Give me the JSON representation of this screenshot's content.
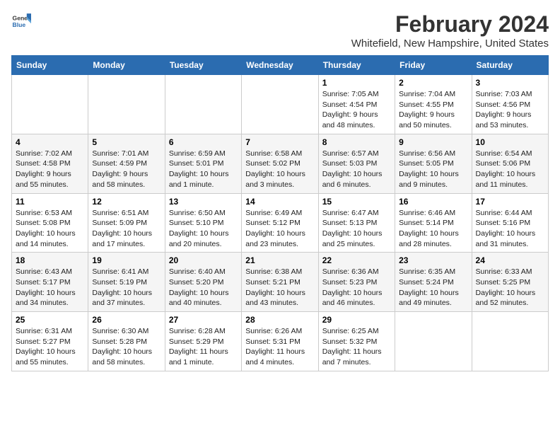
{
  "logo": {
    "general": "General",
    "blue": "Blue"
  },
  "title": "February 2024",
  "subtitle": "Whitefield, New Hampshire, United States",
  "headers": [
    "Sunday",
    "Monday",
    "Tuesday",
    "Wednesday",
    "Thursday",
    "Friday",
    "Saturday"
  ],
  "weeks": [
    [
      {
        "day": "",
        "info": ""
      },
      {
        "day": "",
        "info": ""
      },
      {
        "day": "",
        "info": ""
      },
      {
        "day": "",
        "info": ""
      },
      {
        "day": "1",
        "info": "Sunrise: 7:05 AM\nSunset: 4:54 PM\nDaylight: 9 hours\nand 48 minutes."
      },
      {
        "day": "2",
        "info": "Sunrise: 7:04 AM\nSunset: 4:55 PM\nDaylight: 9 hours\nand 50 minutes."
      },
      {
        "day": "3",
        "info": "Sunrise: 7:03 AM\nSunset: 4:56 PM\nDaylight: 9 hours\nand 53 minutes."
      }
    ],
    [
      {
        "day": "4",
        "info": "Sunrise: 7:02 AM\nSunset: 4:58 PM\nDaylight: 9 hours\nand 55 minutes."
      },
      {
        "day": "5",
        "info": "Sunrise: 7:01 AM\nSunset: 4:59 PM\nDaylight: 9 hours\nand 58 minutes."
      },
      {
        "day": "6",
        "info": "Sunrise: 6:59 AM\nSunset: 5:01 PM\nDaylight: 10 hours\nand 1 minute."
      },
      {
        "day": "7",
        "info": "Sunrise: 6:58 AM\nSunset: 5:02 PM\nDaylight: 10 hours\nand 3 minutes."
      },
      {
        "day": "8",
        "info": "Sunrise: 6:57 AM\nSunset: 5:03 PM\nDaylight: 10 hours\nand 6 minutes."
      },
      {
        "day": "9",
        "info": "Sunrise: 6:56 AM\nSunset: 5:05 PM\nDaylight: 10 hours\nand 9 minutes."
      },
      {
        "day": "10",
        "info": "Sunrise: 6:54 AM\nSunset: 5:06 PM\nDaylight: 10 hours\nand 11 minutes."
      }
    ],
    [
      {
        "day": "11",
        "info": "Sunrise: 6:53 AM\nSunset: 5:08 PM\nDaylight: 10 hours\nand 14 minutes."
      },
      {
        "day": "12",
        "info": "Sunrise: 6:51 AM\nSunset: 5:09 PM\nDaylight: 10 hours\nand 17 minutes."
      },
      {
        "day": "13",
        "info": "Sunrise: 6:50 AM\nSunset: 5:10 PM\nDaylight: 10 hours\nand 20 minutes."
      },
      {
        "day": "14",
        "info": "Sunrise: 6:49 AM\nSunset: 5:12 PM\nDaylight: 10 hours\nand 23 minutes."
      },
      {
        "day": "15",
        "info": "Sunrise: 6:47 AM\nSunset: 5:13 PM\nDaylight: 10 hours\nand 25 minutes."
      },
      {
        "day": "16",
        "info": "Sunrise: 6:46 AM\nSunset: 5:14 PM\nDaylight: 10 hours\nand 28 minutes."
      },
      {
        "day": "17",
        "info": "Sunrise: 6:44 AM\nSunset: 5:16 PM\nDaylight: 10 hours\nand 31 minutes."
      }
    ],
    [
      {
        "day": "18",
        "info": "Sunrise: 6:43 AM\nSunset: 5:17 PM\nDaylight: 10 hours\nand 34 minutes."
      },
      {
        "day": "19",
        "info": "Sunrise: 6:41 AM\nSunset: 5:19 PM\nDaylight: 10 hours\nand 37 minutes."
      },
      {
        "day": "20",
        "info": "Sunrise: 6:40 AM\nSunset: 5:20 PM\nDaylight: 10 hours\nand 40 minutes."
      },
      {
        "day": "21",
        "info": "Sunrise: 6:38 AM\nSunset: 5:21 PM\nDaylight: 10 hours\nand 43 minutes."
      },
      {
        "day": "22",
        "info": "Sunrise: 6:36 AM\nSunset: 5:23 PM\nDaylight: 10 hours\nand 46 minutes."
      },
      {
        "day": "23",
        "info": "Sunrise: 6:35 AM\nSunset: 5:24 PM\nDaylight: 10 hours\nand 49 minutes."
      },
      {
        "day": "24",
        "info": "Sunrise: 6:33 AM\nSunset: 5:25 PM\nDaylight: 10 hours\nand 52 minutes."
      }
    ],
    [
      {
        "day": "25",
        "info": "Sunrise: 6:31 AM\nSunset: 5:27 PM\nDaylight: 10 hours\nand 55 minutes."
      },
      {
        "day": "26",
        "info": "Sunrise: 6:30 AM\nSunset: 5:28 PM\nDaylight: 10 hours\nand 58 minutes."
      },
      {
        "day": "27",
        "info": "Sunrise: 6:28 AM\nSunset: 5:29 PM\nDaylight: 11 hours\nand 1 minute."
      },
      {
        "day": "28",
        "info": "Sunrise: 6:26 AM\nSunset: 5:31 PM\nDaylight: 11 hours\nand 4 minutes."
      },
      {
        "day": "29",
        "info": "Sunrise: 6:25 AM\nSunset: 5:32 PM\nDaylight: 11 hours\nand 7 minutes."
      },
      {
        "day": "",
        "info": ""
      },
      {
        "day": "",
        "info": ""
      }
    ]
  ]
}
